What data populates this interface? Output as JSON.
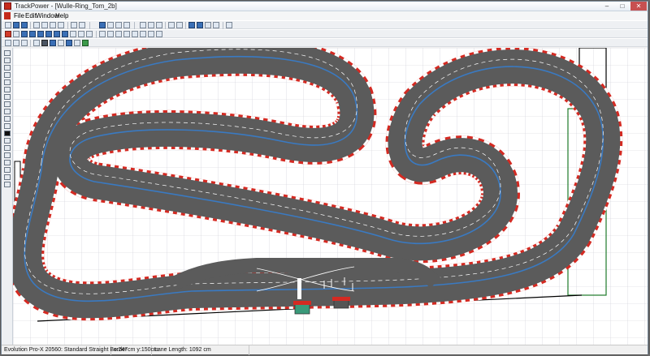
{
  "window": {
    "title": "TrackPower - [Wulle-Ring_Tom_2b]",
    "controls": {
      "minimize": "–",
      "maximize": "□",
      "close": "✕"
    }
  },
  "menubar": {
    "items": [
      {
        "label": "File"
      },
      {
        "label": "Edit"
      },
      {
        "label": "Window"
      },
      {
        "label": "Help"
      }
    ]
  },
  "toolbar": {
    "icons": [
      "new-icon",
      "open-icon",
      "save-icon",
      "print-icon",
      "cut-icon",
      "copy-icon",
      "paste-icon",
      "undo-icon",
      "redo-icon",
      "zoom-icon",
      "grid-icon",
      "layer-icon",
      "settings-icon"
    ]
  },
  "left_tools": {
    "icons": [
      "select-icon",
      "move-icon",
      "rotate-icon",
      "line-icon",
      "pencil-icon",
      "rectangle-icon",
      "ellipse-icon",
      "fill-icon",
      "text-icon",
      "measure-icon",
      "zoom-in-icon",
      "zoom-out-icon"
    ]
  },
  "canvas": {
    "grid": true,
    "colors": {
      "asphalt": "#5b5b5b",
      "lane_divider": "#ffffff",
      "lane_line": "#3a7ac2",
      "border_red": "#d42a22",
      "border_white": "#ffffff",
      "room_wall": "#000000",
      "green_zone": "#1e7a2a"
    }
  },
  "statusbar": {
    "track_piece": "Evolution Pro-X 20560: Standard Straight Border",
    "coords": "x:247cm y:150cm",
    "lane_length": "Lane Length: 1092 cm"
  }
}
